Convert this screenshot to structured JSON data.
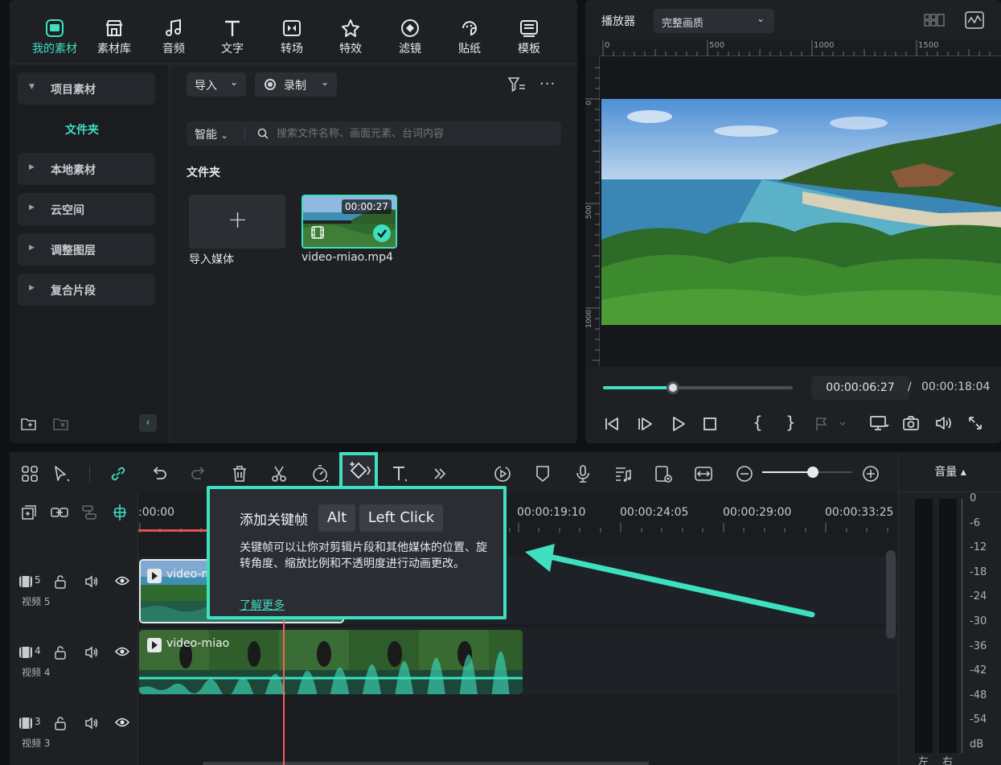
{
  "top_tabs": [
    {
      "label": "我的素材",
      "icon": "my-media-icon",
      "active": true
    },
    {
      "label": "素材库",
      "icon": "stock-media-icon"
    },
    {
      "label": "音频",
      "icon": "audio-icon"
    },
    {
      "label": "文字",
      "icon": "text-icon"
    },
    {
      "label": "转场",
      "icon": "transition-icon"
    },
    {
      "label": "特效",
      "icon": "effects-icon"
    },
    {
      "label": "滤镜",
      "icon": "filters-icon"
    },
    {
      "label": "贴纸",
      "icon": "stickers-icon"
    },
    {
      "label": "模板",
      "icon": "templates-icon"
    }
  ],
  "sidebar": {
    "project_media": "项目素材",
    "folder": "文件夹",
    "items": [
      "本地素材",
      "云空间",
      "调整图层",
      "复合片段"
    ]
  },
  "content": {
    "import_label": "导入",
    "record_label": "录制",
    "smart_label": "智能",
    "search_placeholder": "搜索文件名称、画面元素、台词内容",
    "section_title": "文件夹",
    "import_media_label": "导入媒体",
    "clip": {
      "name": "video-miao.mp4",
      "duration": "00:00:27"
    }
  },
  "player": {
    "title": "播放器",
    "quality": "完整画质",
    "ruler_h": [
      "0",
      "500",
      "1000",
      "1500"
    ],
    "ruler_v": [
      "0",
      "500",
      "1000"
    ],
    "current_time": "00:00:06:27",
    "separator": "/",
    "total_time": "00:00:18:04",
    "progress": 0.37
  },
  "timeline": {
    "ruler_labels": [
      ":00:00",
      "00:00:19:10",
      "00:00:24:05",
      "00:00:29:00",
      "00:00:33:25"
    ],
    "volume_label": "音量 ▴",
    "zoom_level": 0.56,
    "meter_scale": [
      "0",
      "-6",
      "-12",
      "-18",
      "-24",
      "-30",
      "-36",
      "-42",
      "-48",
      "-54",
      "dB"
    ],
    "meter_channels": [
      "左",
      "右"
    ],
    "tracks": [
      {
        "num": "5",
        "name": "视频 5",
        "clip": "video-mi"
      },
      {
        "num": "4",
        "name": "视频 4",
        "clip": "video-miao"
      },
      {
        "num": "3",
        "name": "视频 3",
        "clip": ""
      }
    ]
  },
  "tooltip": {
    "title": "添加关键帧",
    "key1": "Alt",
    "key2": "Left Click",
    "desc": "关键帧可以让你对剪辑片段和其他媒体的位置、旋转角度、缩放比例和不透明度进行动画更改。",
    "link": "了解更多"
  },
  "colors": {
    "accent": "#3ee0c0",
    "playhead": "#ff5a5a",
    "bg": "#1e2024"
  }
}
